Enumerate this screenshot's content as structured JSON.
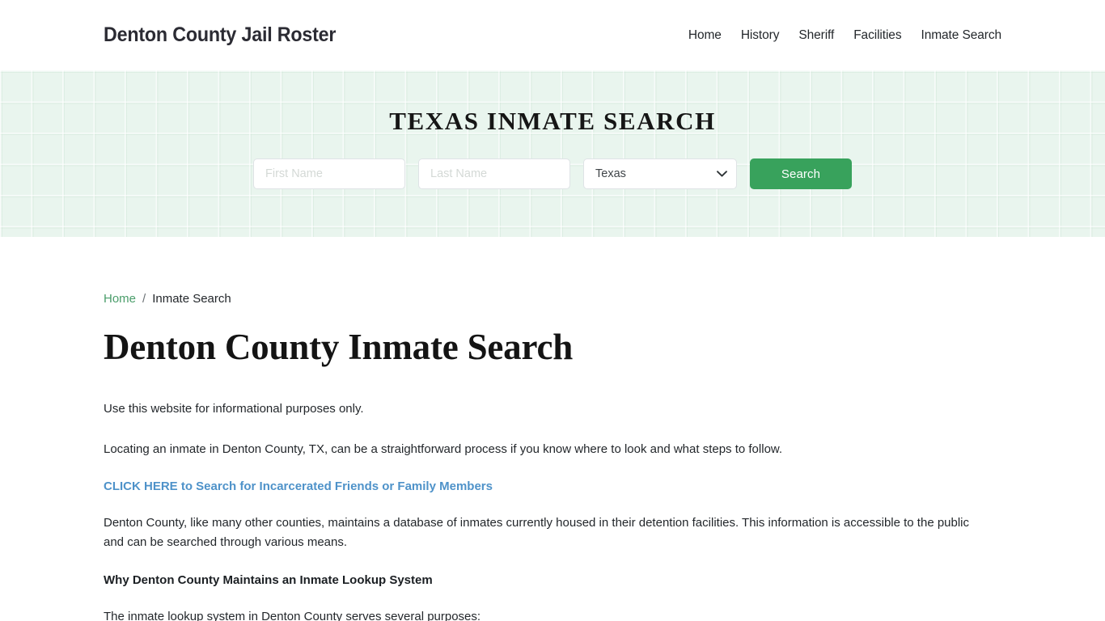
{
  "header": {
    "brand": "Denton County Jail Roster",
    "nav": [
      {
        "label": "Home"
      },
      {
        "label": "History"
      },
      {
        "label": "Sheriff"
      },
      {
        "label": "Facilities"
      },
      {
        "label": "Inmate Search"
      }
    ]
  },
  "hero": {
    "title": "TEXAS INMATE SEARCH",
    "form": {
      "first_name_placeholder": "First Name",
      "first_name_value": "",
      "last_name_placeholder": "Last Name",
      "last_name_value": "",
      "state_selected": "Texas",
      "state_options": [
        "Texas"
      ],
      "search_label": "Search"
    },
    "background_color": "#e9f5ee",
    "accent_color": "#38a25c"
  },
  "breadcrumb": {
    "home_label": "Home",
    "separator": "/",
    "current_label": "Inmate Search",
    "link_color": "#4a9d6a"
  },
  "main": {
    "title": "Denton County Inmate Search",
    "paragraph_1": "Use this website for informational purposes only.",
    "paragraph_2": "Locating an inmate in Denton County, TX, can be a straightforward process if you know where to look and what steps to follow.",
    "cta_link": "CLICK HERE to Search for Incarcerated Friends or Family Members",
    "cta_link_color": "#4e92c9",
    "paragraph_3": "Denton County, like many other counties, maintains a database of inmates currently housed in their detention facilities. This information is accessible to the public and can be searched through various means.",
    "sub_heading": "Why Denton County Maintains an Inmate Lookup System",
    "paragraph_4": "The inmate lookup system in Denton County serves several purposes:"
  }
}
